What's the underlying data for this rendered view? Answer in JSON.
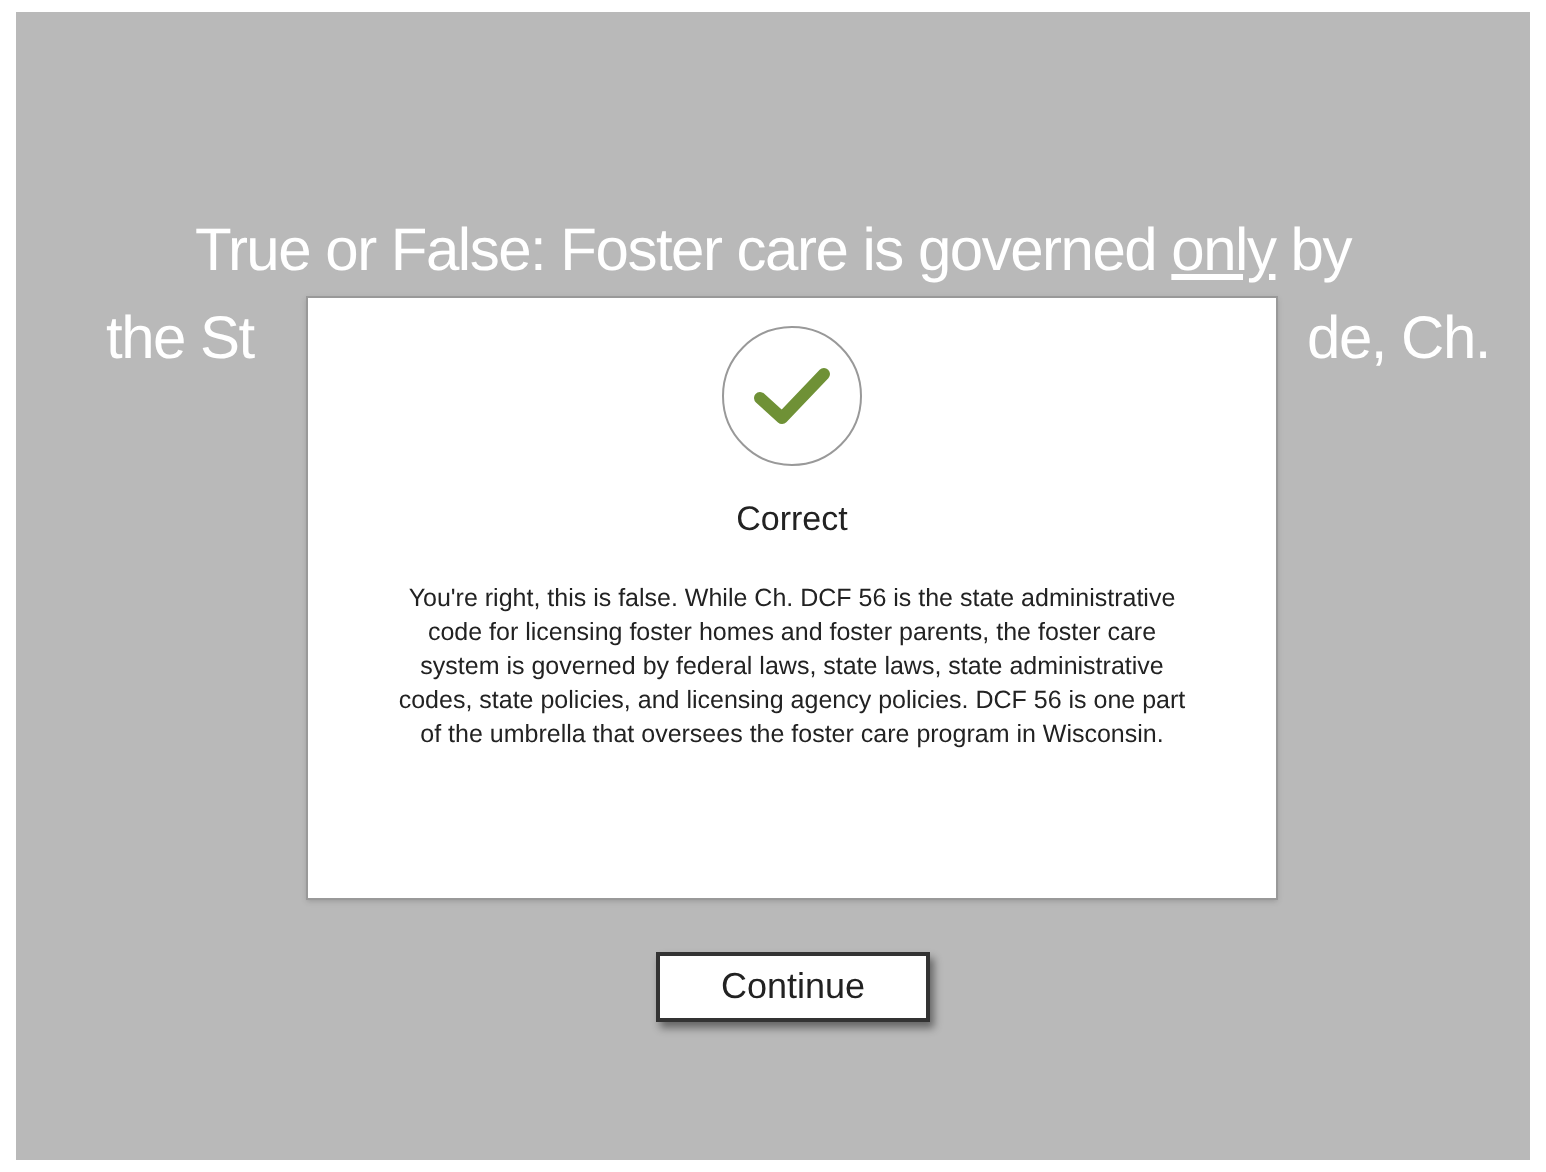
{
  "question": {
    "line_1": [
      {
        "text": "True or False: Foster care is governed ",
        "underlined": false
      },
      {
        "text": "only",
        "underlined": true
      },
      {
        "text": " by",
        "underlined": false
      }
    ],
    "line_2_start": "the St",
    "line_2_end": "de, Ch."
  },
  "feedback": {
    "title": "Correct",
    "message": "You're right, this is false. While Ch. DCF 56 is the state administrative code for licensing foster homes and foster parents, the foster care system is governed by federal laws, state laws, state administrative codes, state policies, and licensing agency policies. DCF 56 is one part of the umbrella that oversees the foster care program in Wisconsin."
  },
  "continue_button": "Continue"
}
